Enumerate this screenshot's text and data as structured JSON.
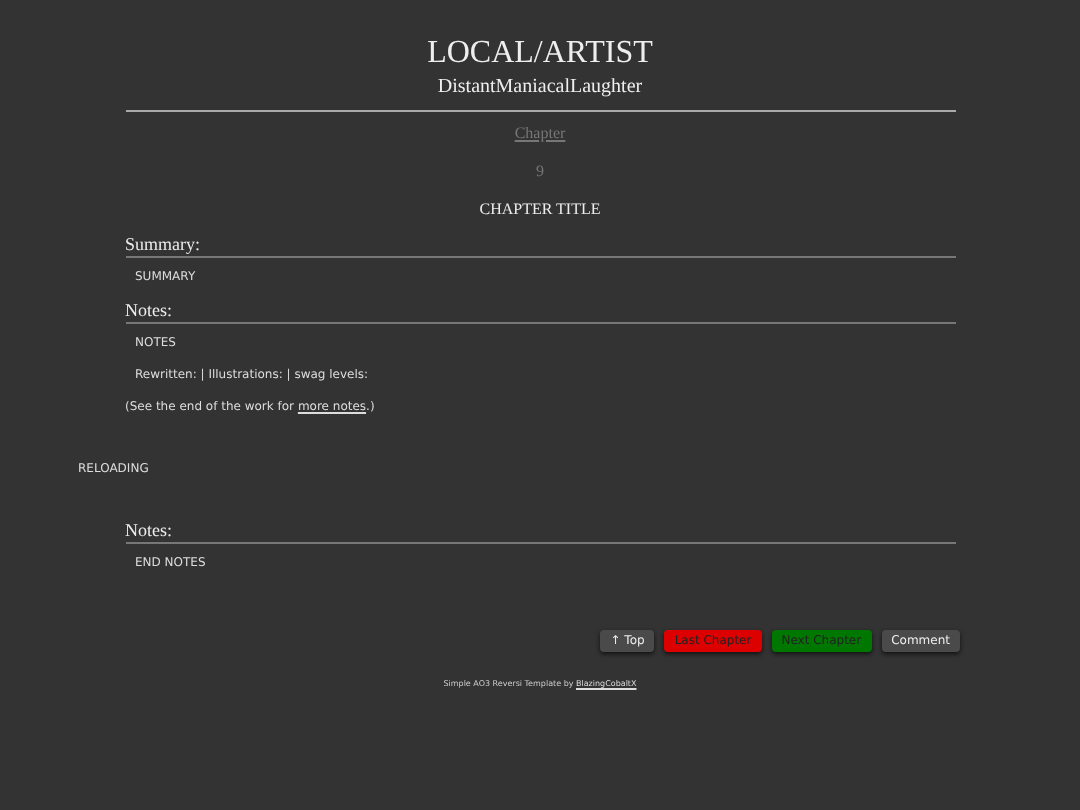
{
  "work": {
    "title": "LOCAL/ARTIST",
    "author": "DistantManiacalLaughter"
  },
  "chapter": {
    "label": "Chapter",
    "number": "9",
    "title": "CHAPTER TITLE"
  },
  "summary": {
    "heading": "Summary:",
    "text": "SUMMARY"
  },
  "notes": {
    "heading": "Notes:",
    "lines": [
      "NOTES",
      "Rewritten: | Illustrations: | swag levels:"
    ],
    "see_end": {
      "before": "(See the end of the work for ",
      "link": "more notes",
      "after": ".)"
    }
  },
  "body": "RELOADING",
  "end_notes": {
    "heading": "Notes:",
    "text": "END NOTES"
  },
  "buttons": [
    {
      "label": "↑ Top",
      "color": "#4a4a4a"
    },
    {
      "label": "Last Chapter",
      "color": "#dd0000"
    },
    {
      "label": "Next Chapter",
      "color": "#007700"
    },
    {
      "label": "Comment",
      "color": "#4a4a4a"
    }
  ],
  "footer": {
    "text": "Simple AO3 Reversi Template by ",
    "link": "BlazingCobaltX"
  }
}
